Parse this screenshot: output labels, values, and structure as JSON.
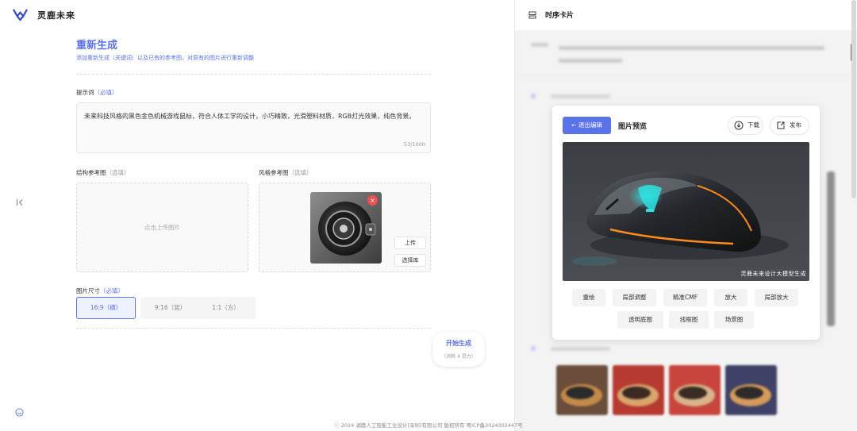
{
  "app": {
    "brand": "灵鹿未来"
  },
  "form": {
    "title": "重新生成",
    "subtitle": "添加重新生成（关键词）以及已有的参考图，对原有的图片进行重新调整",
    "prompt": {
      "label": "提示词",
      "required": "（必填）",
      "value": "未来科技风格的黑色金色机械游戏鼠标，符合人体工学的设计，小巧精致，光滑塑料材质，RGB灯光效果，纯色背景。",
      "counter": "53/1000"
    },
    "structure_ref": {
      "label": "结构参考图",
      "optional": "（选填）",
      "hint": "点击上传图片"
    },
    "style_ref": {
      "label": "风格参考图",
      "optional": "（选填）",
      "upload": "上传",
      "library": "选择库"
    },
    "size": {
      "label": "图片尺寸",
      "required": "（必填）",
      "options": [
        "16:9（横）",
        "9:16（竖）",
        "1:1（方）"
      ],
      "selected": "16:9（横）"
    },
    "generate": {
      "label": "开始生成",
      "cost": "（消耗 4 灵力）"
    }
  },
  "footer": "ⓒ 2024 湖鹿人工智能工业设计(深圳)有限公司 版权所有  粤ICP备2024302447号",
  "timeline": {
    "title": "时序卡片"
  },
  "preview": {
    "exit_label": "退出编辑",
    "title": "图片预览",
    "download": "下载",
    "publish": "发布",
    "watermark": "灵鹿未来设计大模型生成",
    "tools_row1": [
      "重绘",
      "局部调整",
      "精准CMF",
      "放大",
      "局部放大"
    ],
    "tools_row2": [
      "透明底图",
      "线框图",
      "场景图"
    ]
  },
  "colors": {
    "accent": "#5b73e8",
    "danger": "#e95353",
    "glow_orange": "#ff8a1c",
    "glow_cyan": "#2fe0e0"
  },
  "icons": [
    "logo-icon",
    "collapse-left-icon",
    "sync-icon",
    "timeline-icon",
    "arrow-left-icon",
    "download-icon",
    "share-icon",
    "close-icon"
  ]
}
